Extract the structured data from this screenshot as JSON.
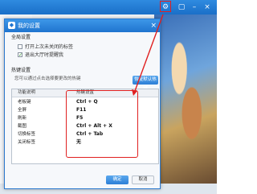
{
  "dialog": {
    "title": "我的设置",
    "close_symbol": "×",
    "global_section_label": "全局设置",
    "options": [
      {
        "label": "打开上次未关闭的标签",
        "checked": false
      },
      {
        "label": "退出大厅时提醒我",
        "checked": true
      }
    ],
    "hotkey_section_label": "热键设置",
    "hotkey_hint": "您可以通过点击选择要更改的热键",
    "restore_button": "恢复默认热键",
    "table": {
      "col_function": "功能说明",
      "col_hotkey": "热键设置",
      "rows": [
        {
          "name": "老板键",
          "key": "Ctrl + Q"
        },
        {
          "name": "全屏",
          "key": "F11"
        },
        {
          "name": "刷新",
          "key": "F5"
        },
        {
          "name": "截图",
          "key": "Ctrl + Alt + X"
        },
        {
          "name": "切换标签",
          "key": "Ctrl + Tab"
        },
        {
          "name": "关闭标签",
          "key": "无"
        }
      ]
    },
    "ok_button": "确定",
    "cancel_button": "取消"
  },
  "titlebar_icons": [
    "settings-gear-icon",
    "restore-icon",
    "minimize-icon",
    "close-icon"
  ],
  "colors": {
    "accent": "#1f74cf",
    "highlight": "#e02020"
  }
}
